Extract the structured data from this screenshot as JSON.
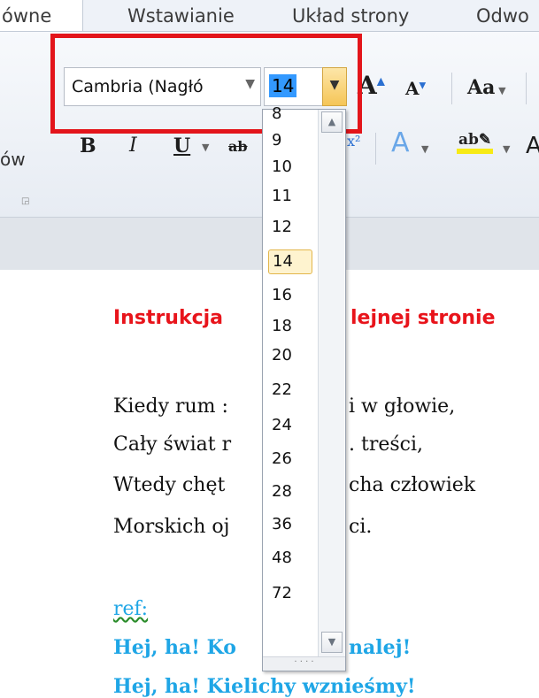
{
  "tabs": {
    "home_partial": "ówne",
    "insert": "Wstawianie",
    "layout": "Układ strony",
    "refs_partial": "Odwo"
  },
  "ribbon": {
    "font_name": "Cambria (Nagłó",
    "font_size": "14",
    "group_partial": "ów",
    "bold": "B",
    "italic": "I",
    "underline": "U",
    "change_case": "Aa"
  },
  "size_list": [
    "8",
    "9",
    "10",
    "11",
    "12",
    "14",
    "16",
    "18",
    "20",
    "22",
    "24",
    "26",
    "28",
    "36",
    "48",
    "72"
  ],
  "size_selected": "14",
  "document": {
    "title_left": "Instrukcja",
    "title_right": "lejnej  stronie",
    "lines": [
      {
        "left": "Kiedy rum :",
        "right": "i w głowie,"
      },
      {
        "left": "Cały świat r",
        "right": ". treści,"
      },
      {
        "left": "Wtedy chęt",
        "right": "cha człowiek"
      },
      {
        "left": "Morskich oj",
        "right": "ci."
      }
    ],
    "ref_label": "ref:",
    "refrain": [
      {
        "left": "Hej, ha! Ko",
        "right": "nalej!"
      },
      {
        "left": "Hej, ha! Kielichy wznieśmy!",
        "right": ""
      }
    ]
  },
  "colors": {
    "highlight_box": "#e3151b",
    "title": "#e8141b",
    "refrain": "#1fa6e6",
    "selected_size_bg": "#fef3cf"
  }
}
